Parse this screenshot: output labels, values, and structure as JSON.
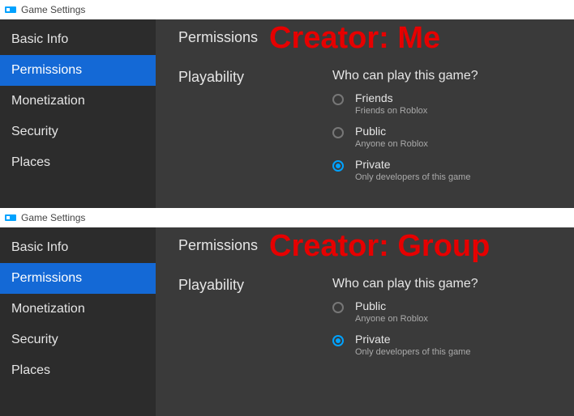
{
  "panels": [
    {
      "titlebar": "Game Settings",
      "overlay": "Creator: Me",
      "sidebar": [
        {
          "label": "Basic Info",
          "active": false
        },
        {
          "label": "Permissions",
          "active": true
        },
        {
          "label": "Monetization",
          "active": false
        },
        {
          "label": "Security",
          "active": false
        },
        {
          "label": "Places",
          "active": false
        }
      ],
      "section_title": "Permissions",
      "field_label": "Playability",
      "field_question": "Who can play this game?",
      "options": [
        {
          "label": "Friends",
          "desc": "Friends on Roblox",
          "selected": false
        },
        {
          "label": "Public",
          "desc": "Anyone on Roblox",
          "selected": false
        },
        {
          "label": "Private",
          "desc": "Only developers of this game",
          "selected": true
        }
      ]
    },
    {
      "titlebar": "Game Settings",
      "overlay": "Creator: Group",
      "sidebar": [
        {
          "label": "Basic Info",
          "active": false
        },
        {
          "label": "Permissions",
          "active": true
        },
        {
          "label": "Monetization",
          "active": false
        },
        {
          "label": "Security",
          "active": false
        },
        {
          "label": "Places",
          "active": false
        }
      ],
      "section_title": "Permissions",
      "field_label": "Playability",
      "field_question": "Who can play this game?",
      "options": [
        {
          "label": "Public",
          "desc": "Anyone on Roblox",
          "selected": false
        },
        {
          "label": "Private",
          "desc": "Only developers of this game",
          "selected": true
        }
      ]
    }
  ]
}
